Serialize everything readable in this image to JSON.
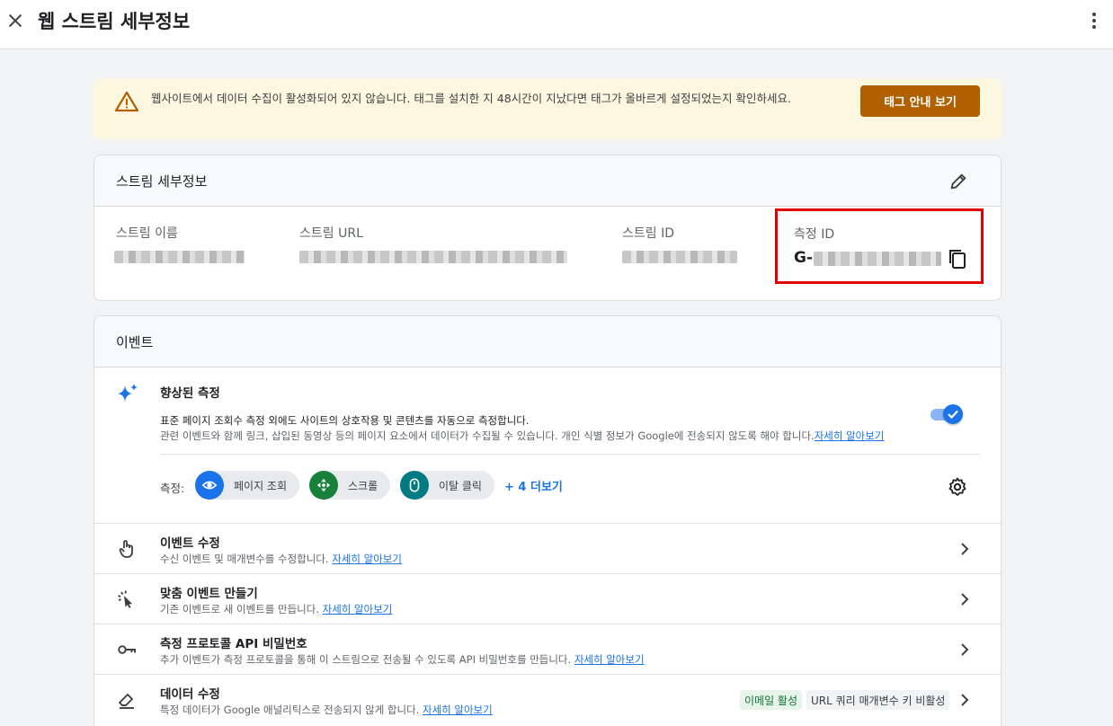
{
  "header": {
    "title": "웹 스트림 세부정보",
    "close_icon": "close-icon",
    "more_icon": "more-vert-icon"
  },
  "banner": {
    "message": "웹사이트에서 데이터 수집이 활성화되어 있지 않습니다. 태그를 설치한 지 48시간이 지났다면 태그가 올바르게 설정되었는지 확인하세요.",
    "button": "태그 안내 보기",
    "button_color": "#b06000",
    "background": "#fef7e0"
  },
  "stream_details": {
    "title": "스트림 세부정보",
    "name_label": "스트림 이름",
    "url_label": "스트림 URL",
    "id_label": "스트림 ID",
    "measurement_id_label": "측정 ID",
    "measurement_id_prefix": "G-"
  },
  "events": {
    "title": "이벤트",
    "enhanced": {
      "title": "향상된 측정",
      "desc_line1": "표준 페이지 조회수 측정 외에도 사이트의 상호작용 및 콘텐츠를 자동으로 측정합니다.",
      "desc_line2": "관련 이벤트와 함께 링크, 삽입된 동영상 등의 페이지 요소에서 데이터가 수집될 수 있습니다. 개인 식별 정보가 Google에 전송되지 않도록 해야 합니다.",
      "learn_more": "자세히 알아보기",
      "toggle_on": true,
      "measuring_label": "측정:",
      "chips": [
        "페이지 조회",
        "스크롤",
        "이탈 클릭"
      ],
      "more_link": "+ 4 더보기"
    },
    "rows": [
      {
        "title": "이벤트 수정",
        "desc": "수신 이벤트 및 매개변수를 수정합니다.",
        "link": "자세히 알아보기"
      },
      {
        "title": "맞춤 이벤트 만들기",
        "desc": "기존 이벤트로 새 이벤트를 만듭니다.",
        "link": "자세히 알아보기"
      },
      {
        "title": "측정 프로토콜 API 비밀번호",
        "desc": "추가 이벤트가 측정 프로토콜을 통해 이 스트림으로 전송될 수 있도록 API 비밀번호를 만듭니다.",
        "link": "자세히 알아보기"
      },
      {
        "title": "데이터 수정",
        "desc": "특정 데이터가 Google 애널리틱스로 전송되지 않게 합니다.",
        "link": "자세히 알아보기",
        "badges": [
          "이메일 활성",
          "URL 쿼리 매개변수 키 비활성"
        ]
      }
    ]
  },
  "colors": {
    "accent_blue": "#1a73e8",
    "highlight_red": "#e00000",
    "chip_blue": "#1a73e8",
    "chip_green": "#188038",
    "chip_teal": "#007b83"
  }
}
